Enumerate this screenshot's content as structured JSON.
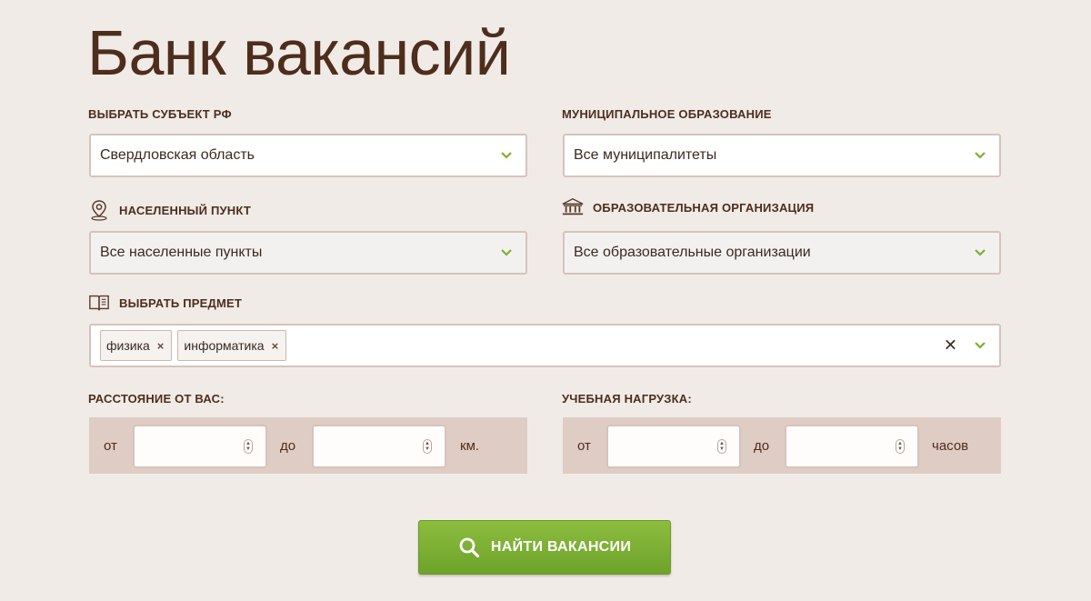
{
  "title": "Банк вакансий",
  "subject": {
    "label": "ВЫБРАТЬ СУБЪЕКТ РФ",
    "value": "Свердловская область"
  },
  "municipality": {
    "label": "МУНИЦИПАЛЬНОЕ ОБРАЗОВАНИЕ",
    "value": "Все муниципалитеты"
  },
  "locality": {
    "label": "НАСЕЛЕННЫЙ ПУНКТ",
    "value": "Все населенные пункты",
    "icon": "location-pin-icon"
  },
  "organization": {
    "label": "ОБРАЗОВАТЕЛЬНАЯ ОРГАНИЗАЦИЯ",
    "value": "Все образовательные организации",
    "icon": "building-columns-icon"
  },
  "subject_matter": {
    "label": "ВЫБРАТЬ ПРЕДМЕТ",
    "icon": "book-icon",
    "tags": [
      {
        "label": "физика",
        "remove": "×"
      },
      {
        "label": "информатика",
        "remove": "×"
      }
    ],
    "clear": "✕"
  },
  "distance": {
    "label": "РАССТОЯНИЕ ОТ ВАС:",
    "from": "от",
    "to": "до",
    "unit": "км.",
    "from_value": "",
    "to_value": ""
  },
  "workload": {
    "label": "УЧЕБНАЯ НАГРУЗКА:",
    "from": "от",
    "to": "до",
    "unit": "часов",
    "from_value": "",
    "to_value": ""
  },
  "search_button": {
    "label": "НАЙТИ ВАКАНСИИ",
    "icon": "search-icon"
  },
  "colors": {
    "background": "#f0ebe7",
    "accent_green": "#7cb033",
    "brown_text": "#4e2d1c",
    "range_bg": "#dfccc5"
  }
}
